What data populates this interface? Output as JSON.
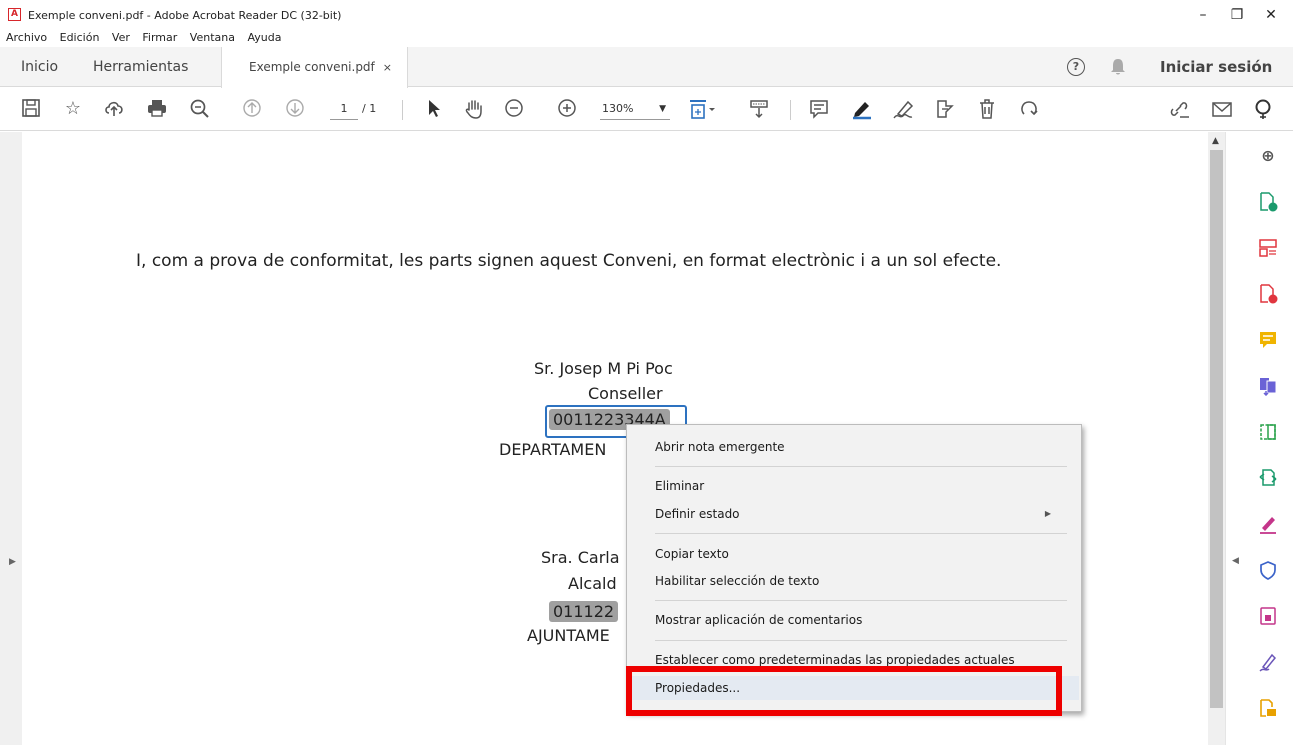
{
  "window": {
    "title": "Exemple conveni.pdf - Adobe Acrobat Reader DC (32-bit)",
    "controls": [
      "–",
      "❐",
      "✕"
    ]
  },
  "menubar": [
    "Archivo",
    "Edición",
    "Ver",
    "Firmar",
    "Ventana",
    "Ayuda"
  ],
  "tabs": {
    "home": "Inicio",
    "tools": "Herramientas",
    "document": "Exemple conveni.pdf",
    "document_close": "×",
    "signin": "Iniciar sesión",
    "help": "?"
  },
  "toolbar": {
    "page_current": "1",
    "page_total": "/ 1",
    "zoom": "130%"
  },
  "document": {
    "sentence": "I, com a prova de conformitat, les parts signen aquest Conveni, en format electrònic i a un sol efecte.",
    "signer1_name": "Sr. Josep M Pi Poc",
    "signer1_role": "Conseller",
    "signer1_id": "0011223344A",
    "signer1_org": "DEPARTAMEN",
    "signer2_name": "Sra. Carla",
    "signer2_role": "Alcald",
    "signer2_id": "011122",
    "signer2_org": "AJUNTAME"
  },
  "context_menu": {
    "open_note": "Abrir nota emergente",
    "delete": "Eliminar",
    "set_status": "Definir estado",
    "copy_text": "Copiar texto",
    "enable_selection": "Habilitar selección de texto",
    "show_comment_app": "Mostrar aplicación de comentarios",
    "set_defaults": "Establecer como predeterminadas las propiedades actuales",
    "properties": "Propiedades..."
  },
  "colors": {
    "accent_highlight": "#ee0000",
    "selection_border": "#2d72c0"
  }
}
